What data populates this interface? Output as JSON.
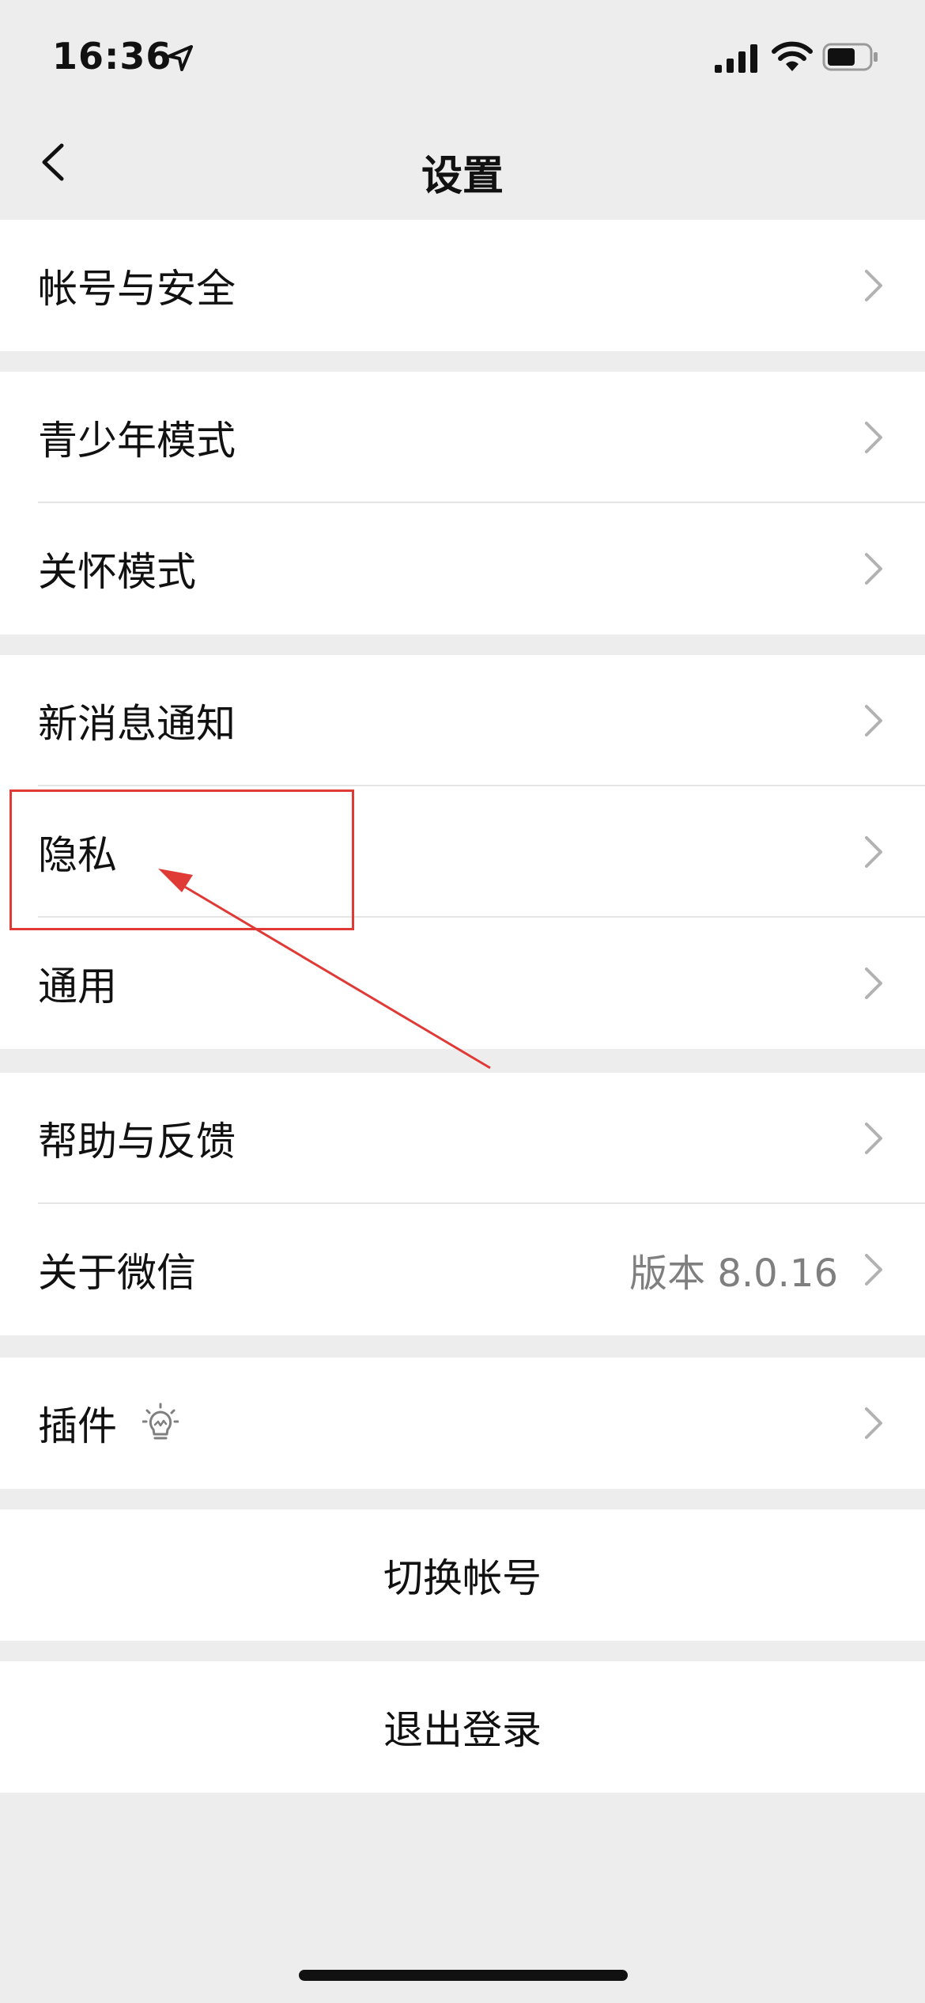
{
  "status_bar": {
    "time": "16:36",
    "icons": [
      "location-arrow-icon",
      "signal-bars-icon",
      "wifi-icon",
      "battery-icon"
    ]
  },
  "nav": {
    "title": "设置",
    "back_icon": "chevron-left-icon"
  },
  "groups": [
    {
      "items": [
        {
          "label": "帐号与安全"
        }
      ]
    },
    {
      "items": [
        {
          "label": "青少年模式"
        },
        {
          "label": "关怀模式"
        }
      ]
    },
    {
      "items": [
        {
          "label": "新消息通知"
        },
        {
          "label": "隐私"
        },
        {
          "label": "通用"
        }
      ]
    },
    {
      "items": [
        {
          "label": "帮助与反馈"
        },
        {
          "label": "关于微信",
          "detail": "版本 8.0.16"
        }
      ]
    },
    {
      "items": [
        {
          "label": "插件",
          "icon": "lightbulb-icon"
        }
      ]
    }
  ],
  "actions": {
    "switch_account": "切换帐号",
    "logout": "退出登录"
  },
  "colors": {
    "background": "#ededed",
    "cell": "#ffffff",
    "separator": "#e5e5e5",
    "detail_text": "#7f7f7f",
    "chevron": "#b2b2b2",
    "annotation": "#e03a36"
  }
}
